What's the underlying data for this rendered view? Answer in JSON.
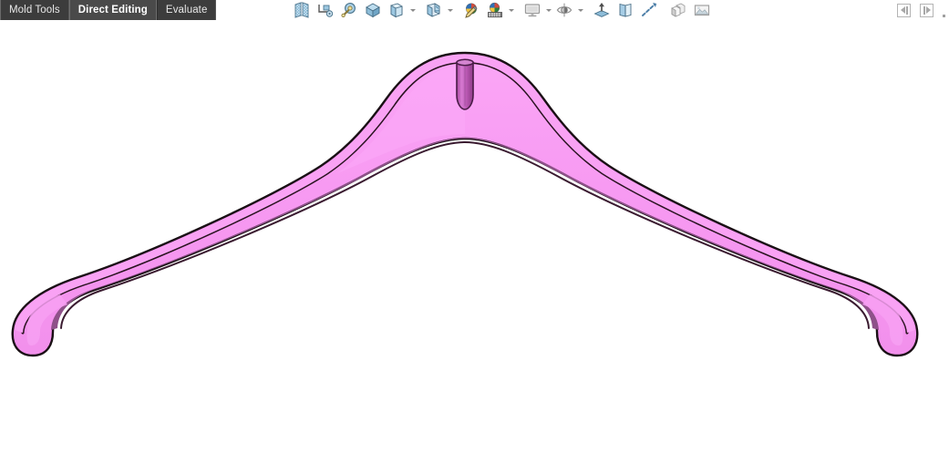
{
  "window": {
    "background_color": "#ffffff"
  },
  "tabs": {
    "items": [
      {
        "label": "Mold Tools",
        "active": false
      },
      {
        "label": "Direct Editing",
        "active": true
      },
      {
        "label": "Evaluate",
        "active": false
      }
    ],
    "bar_color": "#3c3c3c",
    "active_color": "#4a4a4a",
    "text_color": "#e8e8e8"
  },
  "toolbar": {
    "items": [
      {
        "name": "parting-surface-icon",
        "label": "Parting Surfaces",
        "dropdown": false,
        "enabled": true
      },
      {
        "name": "ruled-surface-icon",
        "label": "Ruled Surface",
        "dropdown": false,
        "enabled": true
      },
      {
        "name": "measure-icon",
        "label": "Measure",
        "dropdown": false,
        "enabled": true
      },
      {
        "name": "mass-properties-icon",
        "label": "Mass Properties",
        "dropdown": false,
        "enabled": true
      },
      {
        "name": "section-view-icon",
        "label": "Section View",
        "dropdown": true,
        "enabled": true
      },
      {
        "name": "draft-analysis-icon",
        "label": "Draft Analysis",
        "dropdown": true,
        "enabled": true
      },
      {
        "name": "edit-appearance-icon",
        "label": "Edit Appearance",
        "dropdown": false,
        "enabled": true
      },
      {
        "name": "edit-scene-icon",
        "label": "Edit Scene",
        "dropdown": true,
        "enabled": true
      },
      {
        "name": "display-style-icon",
        "label": "Display Style",
        "dropdown": true,
        "enabled": false
      },
      {
        "name": "hide-show-items-icon",
        "label": "Hide/Show Items",
        "dropdown": true,
        "enabled": false
      },
      {
        "name": "apply-scene-icon",
        "label": "Apply Scene",
        "dropdown": false,
        "enabled": true
      },
      {
        "name": "view-orientation-icon",
        "label": "View Orientation",
        "dropdown": false,
        "enabled": true
      },
      {
        "name": "perspective-icon",
        "label": "Perspective",
        "dropdown": false,
        "enabled": true
      },
      {
        "name": "hidden-lines-icon",
        "label": "Hidden Lines Visible",
        "dropdown": false,
        "enabled": false
      },
      {
        "name": "viewport-image-icon",
        "label": "Viewport",
        "dropdown": false,
        "enabled": false
      }
    ]
  },
  "right_nav": {
    "collapse_left_label": "Collapse left panel",
    "expand_right_label": "Expand right panel"
  },
  "model": {
    "name": "clothes-hanger",
    "description": "3D shaded solid model of a clothes hanger shown in front view",
    "body_fill_color": "#f79af2",
    "body_edge_color": "#8e5189",
    "outline_color": "#1a1015",
    "hook_stub_color": "#c05fc0",
    "hook_stub_shadow_color": "#9b4a9b",
    "canvas_background": "#ffffff",
    "shaded_with_edges": true
  }
}
